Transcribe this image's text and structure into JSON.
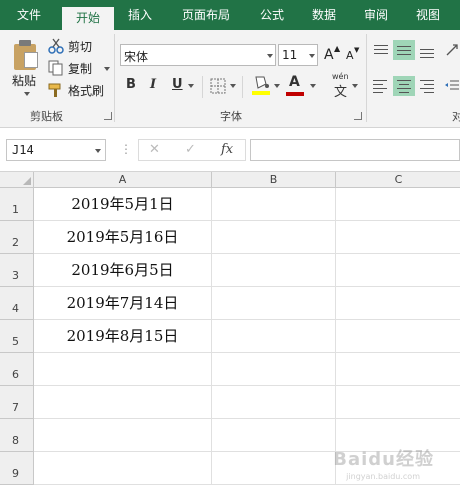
{
  "ribbon": {
    "tabs": [
      "文件",
      "开始",
      "插入",
      "页面布局",
      "公式",
      "数据",
      "审阅",
      "视图"
    ],
    "active_tab": "开始",
    "clipboard": {
      "paste": "粘贴",
      "cut": "剪切",
      "copy": "复制",
      "format_painter": "格式刷",
      "group_label": "剪贴板"
    },
    "font": {
      "font_name": "宋体",
      "font_size": "11",
      "grow_label": "A",
      "shrink_label": "A",
      "bold": "B",
      "italic": "I",
      "underline": "U",
      "color_label": "A",
      "wen_top": "wén",
      "wen_char": "文",
      "group_label": "字体",
      "highlight_color": "#ffff00",
      "font_color": "#c00000"
    },
    "alignment": {
      "group_label_partial": "对"
    }
  },
  "formula_bar": {
    "name_box": "J14",
    "cancel": "✕",
    "enter": "✓",
    "fx": "fx",
    "formula": ""
  },
  "sheet": {
    "columns": [
      "A",
      "B",
      "C"
    ],
    "rows": [
      {
        "num": "1",
        "a": "2019年5月1日"
      },
      {
        "num": "2",
        "a": "2019年5月16日"
      },
      {
        "num": "3",
        "a": "2019年6月5日"
      },
      {
        "num": "4",
        "a": "2019年7月14日"
      },
      {
        "num": "5",
        "a": "2019年8月15日"
      },
      {
        "num": "6",
        "a": ""
      },
      {
        "num": "7",
        "a": ""
      },
      {
        "num": "8",
        "a": ""
      },
      {
        "num": "9",
        "a": ""
      }
    ]
  },
  "watermark": {
    "brand": "Baidu经验",
    "sub": "jingyan.baidu.com"
  },
  "theme": {
    "accent": "#217346",
    "selected_align": "#9fd5b7"
  }
}
